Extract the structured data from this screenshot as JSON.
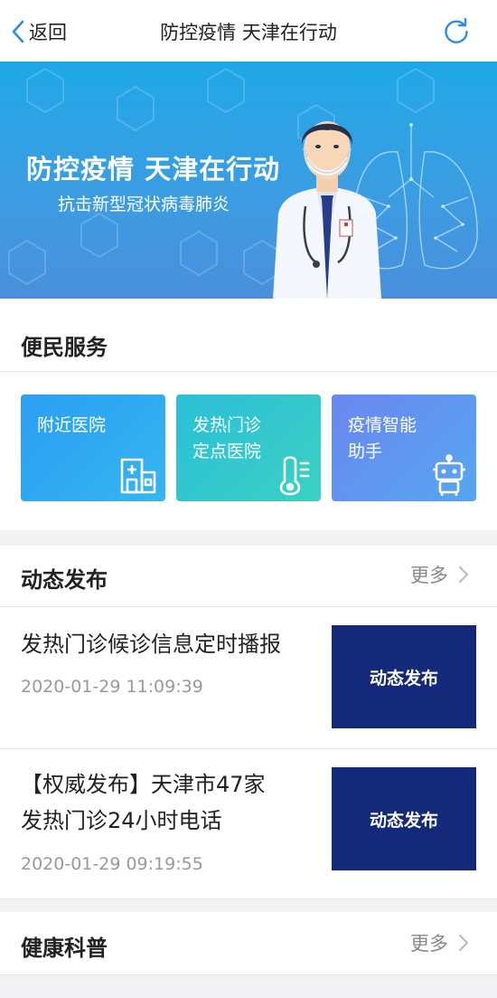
{
  "nav": {
    "back_label": "返回",
    "title": "防控疫情 天津在行动",
    "back_icon": "chevron-left-icon",
    "refresh_icon": "refresh-icon"
  },
  "banner": {
    "title": "防控疫情 天津在行动",
    "subtitle": "抗击新型冠状病毒肺炎"
  },
  "services": {
    "title": "便民服务",
    "cards": [
      {
        "label": "附近医院",
        "icon": "hospital-building-icon",
        "color": "#2b9ff2"
      },
      {
        "label": "发热门诊\n定点医院",
        "icon": "thermometer-icon",
        "color": "#2bbfd8"
      },
      {
        "label": "疫情智能\n助手",
        "icon": "robot-icon",
        "color": "#6b87f0"
      }
    ]
  },
  "dynamic": {
    "title": "动态发布",
    "more_label": "更多",
    "items": [
      {
        "title": "发热门诊候诊信息定时播报",
        "time": "2020-01-29 11:09:39",
        "thumb_text": "动态发布"
      },
      {
        "title": "【权威发布】天津市47家\n发热门诊24小时电话",
        "time": "2020-01-29 09:19:55",
        "thumb_text": "动态发布"
      }
    ]
  },
  "health": {
    "title": "健康科普",
    "more_label": "更多"
  },
  "colors": {
    "accent": "#2d8ce4",
    "thumb_bg": "#14297a"
  }
}
